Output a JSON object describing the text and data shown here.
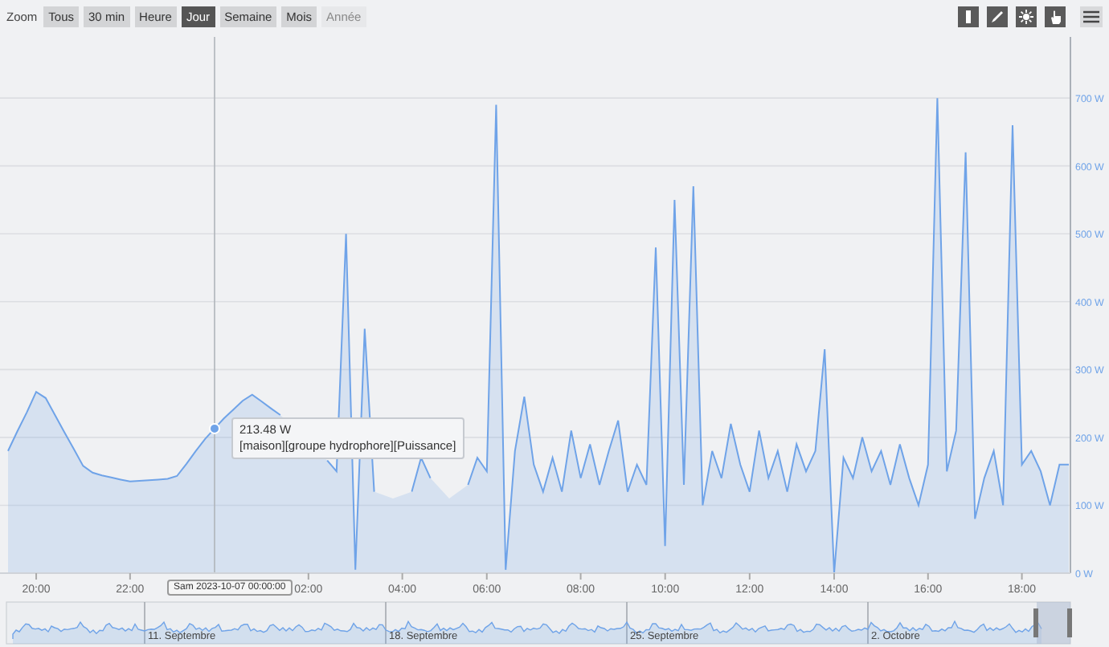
{
  "toolbar": {
    "zoom_label": "Zoom",
    "ranges": [
      {
        "label": "Tous",
        "selected": false,
        "disabled": false
      },
      {
        "label": "30 min",
        "selected": false,
        "disabled": false
      },
      {
        "label": "Heure",
        "selected": false,
        "disabled": false
      },
      {
        "label": "Jour",
        "selected": true,
        "disabled": false
      },
      {
        "label": "Semaine",
        "selected": false,
        "disabled": false
      },
      {
        "label": "Mois",
        "selected": false,
        "disabled": false
      },
      {
        "label": "Année",
        "selected": false,
        "disabled": true
      }
    ]
  },
  "chart": {
    "chart_data": {
      "type": "area",
      "categories": [
        null,
        null,
        null,
        "20:00",
        null,
        null,
        null,
        null,
        null,
        null,
        null,
        null,
        null,
        "22:00",
        null,
        null,
        null,
        null,
        null,
        null,
        null,
        null,
        null,
        null,
        null,
        null,
        null,
        null,
        null,
        null,
        null,
        null,
        "02:00",
        null,
        null,
        null,
        null,
        null,
        null,
        null,
        null,
        null,
        "04:00",
        null,
        null,
        null,
        null,
        null,
        null,
        null,
        null,
        "06:00",
        null,
        null,
        null,
        null,
        null,
        null,
        null,
        null,
        null,
        "08:00",
        null,
        null,
        null,
        null,
        null,
        null,
        null,
        null,
        "10:00",
        null,
        null,
        null,
        null,
        null,
        null,
        null,
        null,
        "12:00",
        null,
        null,
        null,
        null,
        null,
        null,
        null,
        null,
        "14:00",
        null,
        null,
        null,
        null,
        null,
        null,
        null,
        null,
        null,
        "16:00",
        null,
        null,
        null,
        null,
        null,
        null,
        null,
        null,
        null,
        "18:00",
        null,
        null,
        null,
        null,
        null
      ],
      "series": [
        {
          "color": "#6fa3e8",
          "values": [
            180,
            209,
            237,
            267,
            258,
            233,
            208,
            183,
            158,
            148,
            144,
            141,
            138,
            135,
            136,
            137,
            138,
            139,
            143,
            161,
            180,
            198,
            213,
            228,
            241,
            254,
            263,
            253,
            243,
            233,
            null,
            null,
            null,
            null,
            166,
            150,
            500,
            5,
            360,
            120,
            null,
            110,
            null,
            120,
            170,
            140,
            null,
            110,
            null,
            130,
            170,
            150,
            690,
            5,
            180,
            260,
            160,
            120,
            170,
            120,
            210,
            140,
            190,
            130,
            180,
            225,
            120,
            160,
            130,
            480,
            40,
            550,
            130,
            570,
            100,
            180,
            140,
            220,
            160,
            120,
            210,
            140,
            180,
            120,
            190,
            150,
            180,
            330,
            0,
            170,
            140,
            200,
            150,
            180,
            130,
            190,
            140,
            100,
            160,
            700,
            150,
            210,
            620,
            80,
            140,
            180,
            100,
            660,
            160,
            180,
            150,
            100,
            160,
            160
          ]
        }
      ],
      "ylim": [
        0,
        790
      ],
      "grid": true,
      "yticks": [
        {
          "value": 0,
          "label": "0 W"
        },
        {
          "value": 100,
          "label": "100 W"
        },
        {
          "value": 200,
          "label": "200 W"
        },
        {
          "value": 300,
          "label": "300 W"
        },
        {
          "value": 400,
          "label": "400 W"
        },
        {
          "value": 500,
          "label": "500 W"
        },
        {
          "value": 600,
          "label": "600 W"
        },
        {
          "value": 700,
          "label": "700 W"
        }
      ]
    },
    "tooltip": {
      "value": "213.48 W",
      "series": "[maison][groupe hydrophore][Puissance]"
    },
    "crosshair_label": "Sam 2023-10-07 00:00:00"
  },
  "navigator": {
    "labels": [
      "11. Septembre",
      "18. Septembre",
      "25. Septembre",
      "2. Octobre"
    ]
  }
}
